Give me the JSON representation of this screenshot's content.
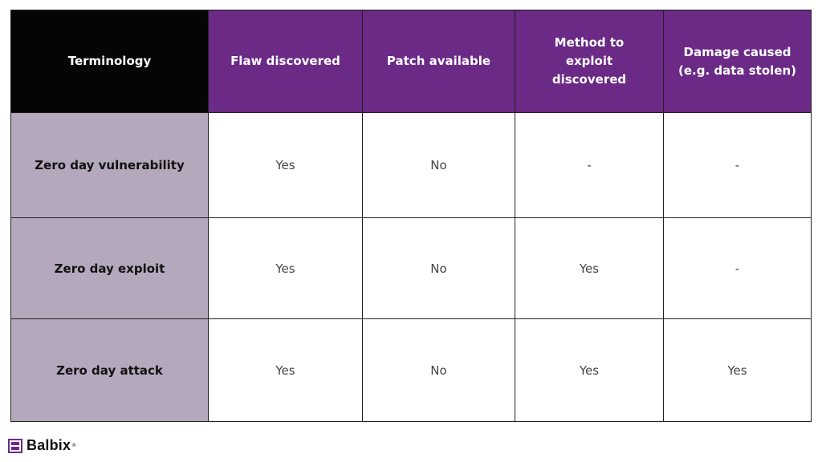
{
  "table": {
    "headers": [
      "Terminology",
      "Flaw discovered",
      "Patch available",
      "Method to exploit discovered",
      "Damage caused (e.g. data stolen)"
    ],
    "rows": [
      {
        "term": "Zero day vulnerability",
        "values": [
          "Yes",
          "No",
          "-",
          "-"
        ]
      },
      {
        "term": "Zero day exploit",
        "values": [
          "Yes",
          "No",
          "Yes",
          "-"
        ]
      },
      {
        "term": "Zero day attack",
        "values": [
          "Yes",
          "No",
          "Yes",
          "Yes"
        ]
      }
    ]
  },
  "colors": {
    "header_term_bg": "#050505",
    "header_bg": "#6b2a86",
    "rowhead_bg": "#b5a8bd"
  },
  "logo": {
    "name": "Balbix",
    "reg_mark": "®"
  }
}
